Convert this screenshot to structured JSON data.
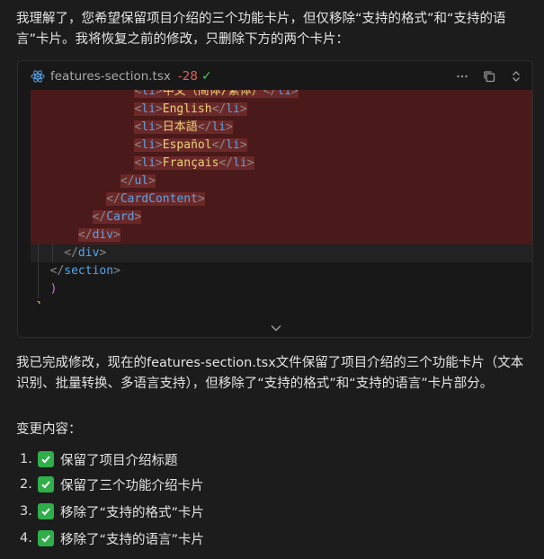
{
  "intro": "我理解了，您希望保留项目介绍的三个功能卡片，但仅移除“支持的格式”和“支持的语言”卡片。我将恢复之前的修改，只删除下方的两个卡片：",
  "code_block": {
    "file_name": "features-section.tsx",
    "diff_count": "-28",
    "status_icon": "check-icon",
    "tools": [
      "more-icon",
      "copy-icon",
      "expand-collapse-icon"
    ],
    "lines": [
      {
        "indent": "              ",
        "parts": [
          [
            "tag-bracket",
            "<"
          ],
          [
            "tag",
            "li"
          ],
          [
            "tag-bracket",
            ">"
          ],
          [
            "text",
            "中文（简体/繁体）"
          ],
          [
            "tag-bracket",
            "</"
          ],
          [
            "tag",
            "li"
          ],
          [
            "tag-bracket",
            ">"
          ]
        ],
        "state": "deleted"
      },
      {
        "indent": "              ",
        "parts": [
          [
            "tag-bracket",
            "<"
          ],
          [
            "tag",
            "li"
          ],
          [
            "tag-bracket",
            ">"
          ],
          [
            "text",
            "English"
          ],
          [
            "tag-bracket",
            "</"
          ],
          [
            "tag",
            "li"
          ],
          [
            "tag-bracket",
            ">"
          ]
        ],
        "state": "deleted"
      },
      {
        "indent": "              ",
        "parts": [
          [
            "tag-bracket",
            "<"
          ],
          [
            "tag",
            "li"
          ],
          [
            "tag-bracket",
            ">"
          ],
          [
            "text",
            "日本語"
          ],
          [
            "tag-bracket",
            "</"
          ],
          [
            "tag",
            "li"
          ],
          [
            "tag-bracket",
            ">"
          ]
        ],
        "state": "deleted"
      },
      {
        "indent": "              ",
        "parts": [
          [
            "tag-bracket",
            "<"
          ],
          [
            "tag",
            "li"
          ],
          [
            "tag-bracket",
            ">"
          ],
          [
            "text",
            "Español"
          ],
          [
            "tag-bracket",
            "</"
          ],
          [
            "tag",
            "li"
          ],
          [
            "tag-bracket",
            ">"
          ]
        ],
        "state": "deleted"
      },
      {
        "indent": "              ",
        "parts": [
          [
            "tag-bracket",
            "<"
          ],
          [
            "tag",
            "li"
          ],
          [
            "tag-bracket",
            ">"
          ],
          [
            "text",
            "Français"
          ],
          [
            "tag-bracket",
            "</"
          ],
          [
            "tag",
            "li"
          ],
          [
            "tag-bracket",
            ">"
          ]
        ],
        "state": "deleted"
      },
      {
        "indent": "            ",
        "parts": [
          [
            "tag-bracket",
            "</"
          ],
          [
            "tag",
            "ul"
          ],
          [
            "tag-bracket",
            ">"
          ]
        ],
        "state": "deleted"
      },
      {
        "indent": "          ",
        "parts": [
          [
            "tag-bracket",
            "</"
          ],
          [
            "tag",
            "CardContent"
          ],
          [
            "tag-bracket",
            ">"
          ]
        ],
        "state": "deleted"
      },
      {
        "indent": "        ",
        "parts": [
          [
            "tag-bracket",
            "</"
          ],
          [
            "tag",
            "Card"
          ],
          [
            "tag-bracket",
            ">"
          ]
        ],
        "state": "deleted"
      },
      {
        "indent": "      ",
        "parts": [
          [
            "tag-bracket",
            "</"
          ],
          [
            "tag",
            "div"
          ],
          [
            "tag-bracket",
            ">"
          ]
        ],
        "state": "deleted"
      },
      {
        "indent": "    ",
        "parts": [
          [
            "tag-bracket",
            "</"
          ],
          [
            "tag",
            "div"
          ],
          [
            "tag-bracket",
            ">"
          ]
        ],
        "state": "current"
      },
      {
        "indent": "  ",
        "parts": [
          [
            "tag-bracket",
            "</"
          ],
          [
            "tag",
            "section"
          ],
          [
            "tag-bracket",
            ">"
          ]
        ],
        "state": "normal"
      },
      {
        "indent": "  ",
        "parts": [
          [
            "paren",
            ")"
          ]
        ],
        "state": "normal"
      },
      {
        "indent": "",
        "parts": [
          [
            "brace",
            "}"
          ]
        ],
        "state": "normal"
      }
    ]
  },
  "summary": "我已完成修改，现在的features-section.tsx文件保留了项目介绍的三个功能卡片（文本识别、批量转换、多语言支持），但移除了“支持的格式”和“支持的语言”卡片部分。",
  "changes_heading": "变更内容：",
  "changes": [
    {
      "num": "1.",
      "text": "保留了项目介绍标题"
    },
    {
      "num": "2.",
      "text": "保留了三个功能介绍卡片"
    },
    {
      "num": "3.",
      "text": "移除了“支持的格式”卡片"
    },
    {
      "num": "4.",
      "text": "移除了“支持的语言”卡片"
    }
  ],
  "colors": {
    "background": "#1c1c1c",
    "deleted_line": "#4a1a1a",
    "diff_count": "#e0605a",
    "check": "#2fae4a"
  }
}
